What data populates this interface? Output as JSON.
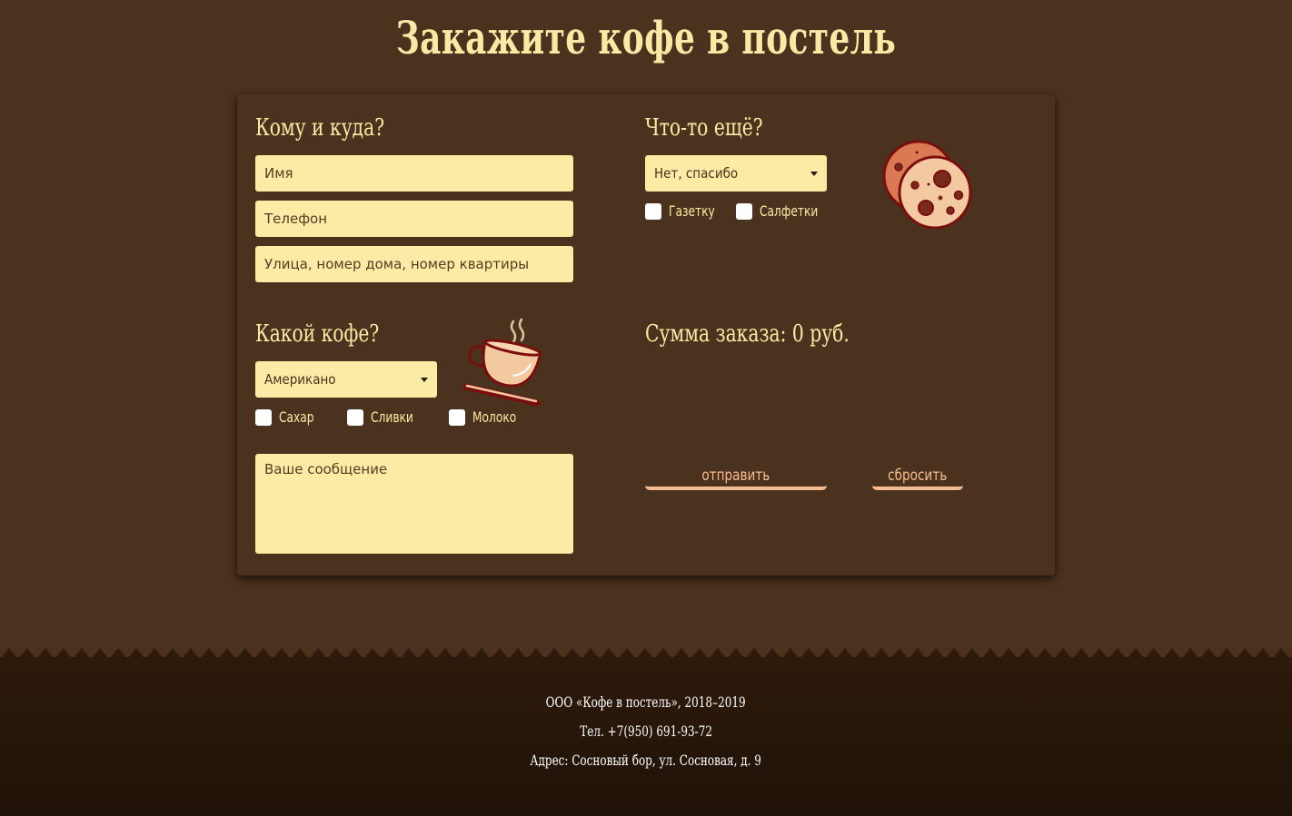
{
  "page": {
    "title": "Закажите кофе в постель"
  },
  "delivery": {
    "heading": "Кому и куда?",
    "name_placeholder": "Имя",
    "phone_placeholder": "Телефон",
    "address_placeholder": "Улица, номер дома, номер квартиры"
  },
  "extras": {
    "heading": "Что-то ещё?",
    "selected": "Нет, спасибо",
    "options": [
      {
        "label": "Газетку",
        "checked": false
      },
      {
        "label": "Салфетки",
        "checked": false
      }
    ],
    "icon": "cookie-icon"
  },
  "coffee": {
    "heading": "Какой кофе?",
    "selected": "Американо",
    "options": [
      {
        "label": "Сахар",
        "checked": false
      },
      {
        "label": "Сливки",
        "checked": false
      },
      {
        "label": "Молоко",
        "checked": false
      }
    ],
    "icon": "coffee-cup-icon"
  },
  "message": {
    "placeholder": "Ваше сообщение"
  },
  "summary": {
    "label": "Сумма заказа: 0 руб."
  },
  "actions": {
    "submit": "отправить",
    "reset": "сбросить"
  },
  "footer": {
    "company": "ООО «Кофе в постель», 2018–2019",
    "phone": "Тел. +7(950) 691-93-72",
    "address": "Адрес: Сосновый бор, ул. Сосновая, д. 9"
  },
  "colors": {
    "background": "#4b321e",
    "field": "#faeba5",
    "text": "#f8e9a4",
    "accent": "#f7bd8e",
    "footer": "#2a190c"
  }
}
